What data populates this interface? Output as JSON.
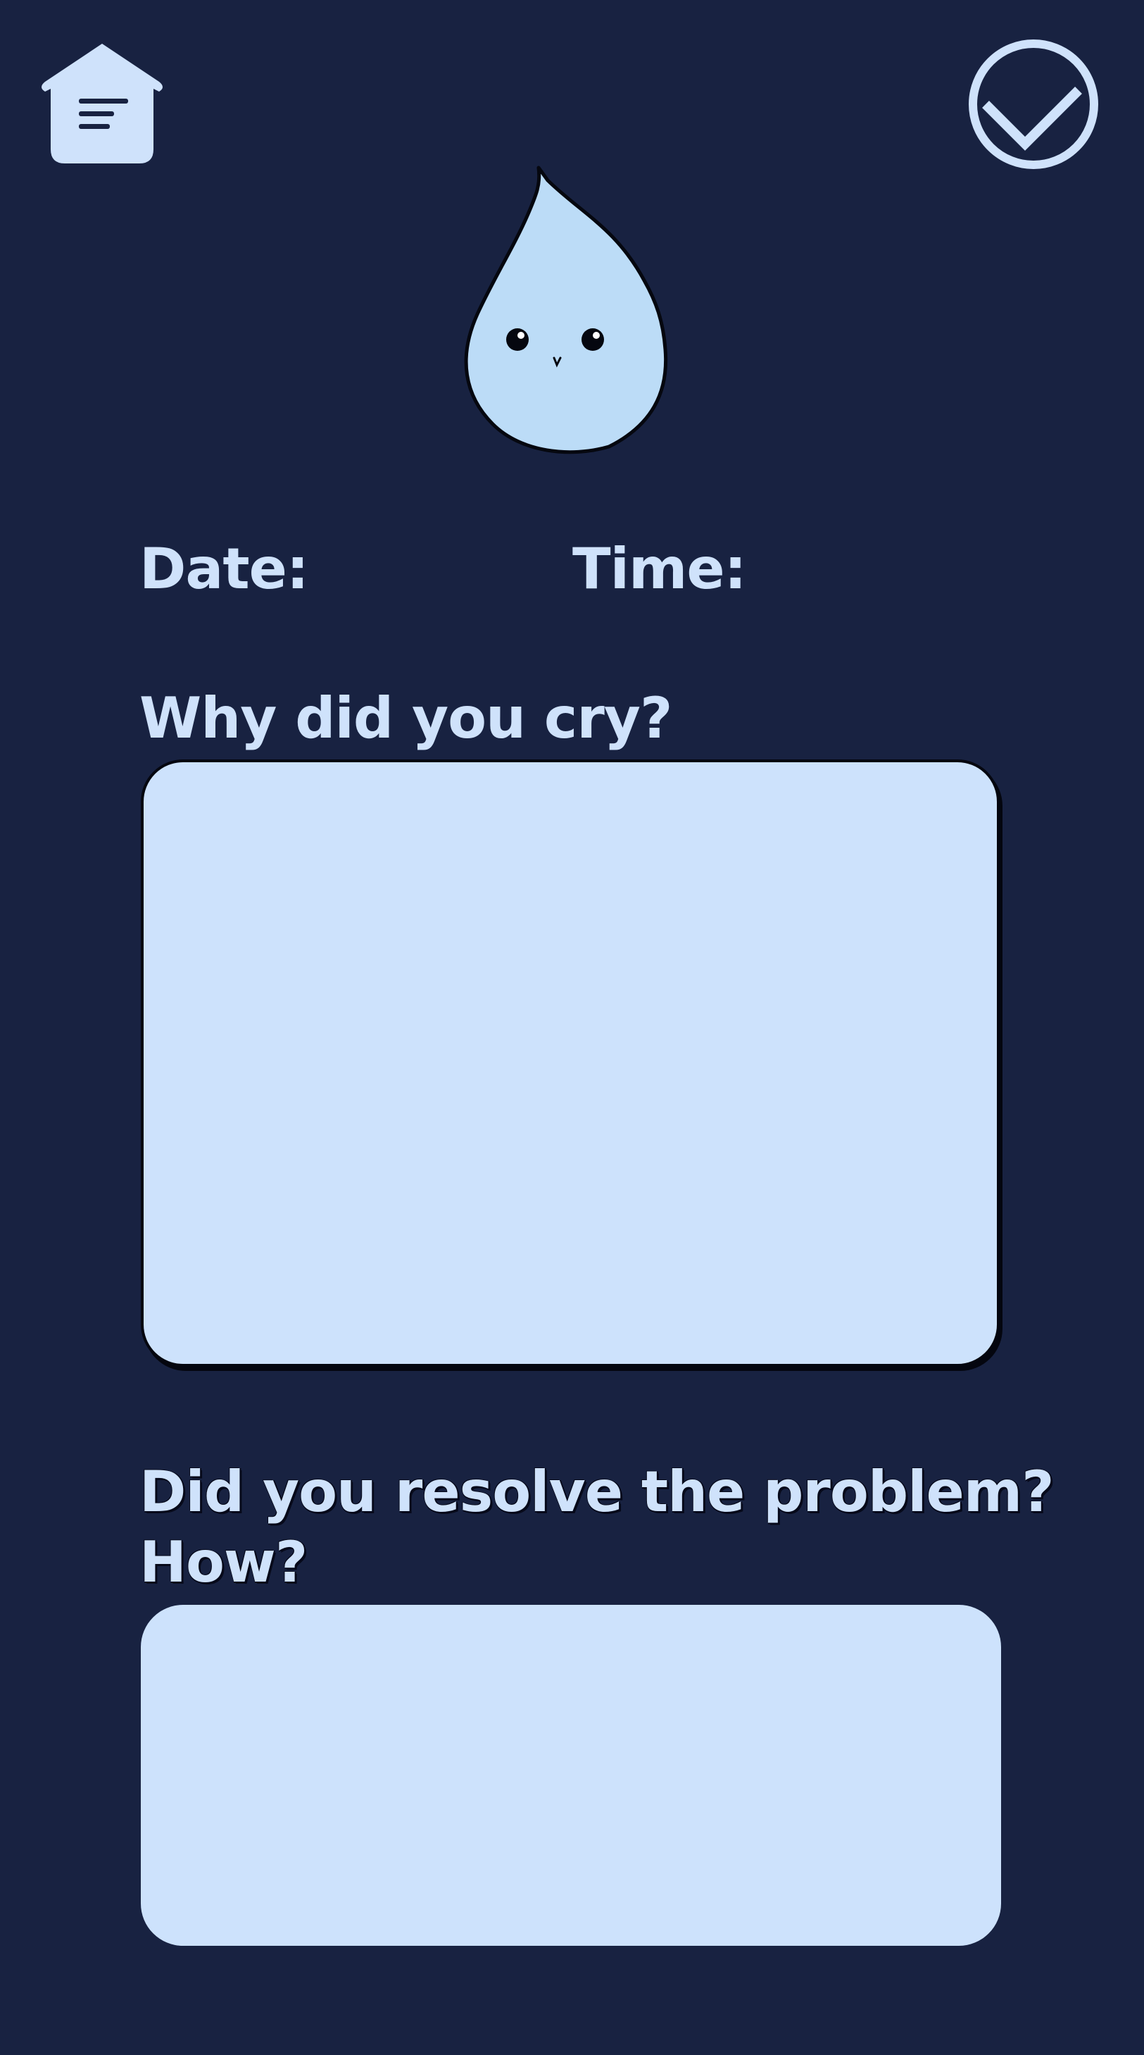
{
  "header": {
    "home_icon": "house-menu-icon",
    "done_icon": "circle-check-icon"
  },
  "mascot": {
    "icon": "water-drop-mascot"
  },
  "form": {
    "date_label": "Date:",
    "time_label": "Time:",
    "why_label": "Why did you cry?",
    "why_value": "",
    "resolve_label": "Did you resolve the problem? How?",
    "resolve_value": ""
  },
  "colors": {
    "background": "#182241",
    "accent": "#cfe2fb",
    "input_fill": "#cde2fc",
    "mascot_fill": "#bcdcf7"
  }
}
